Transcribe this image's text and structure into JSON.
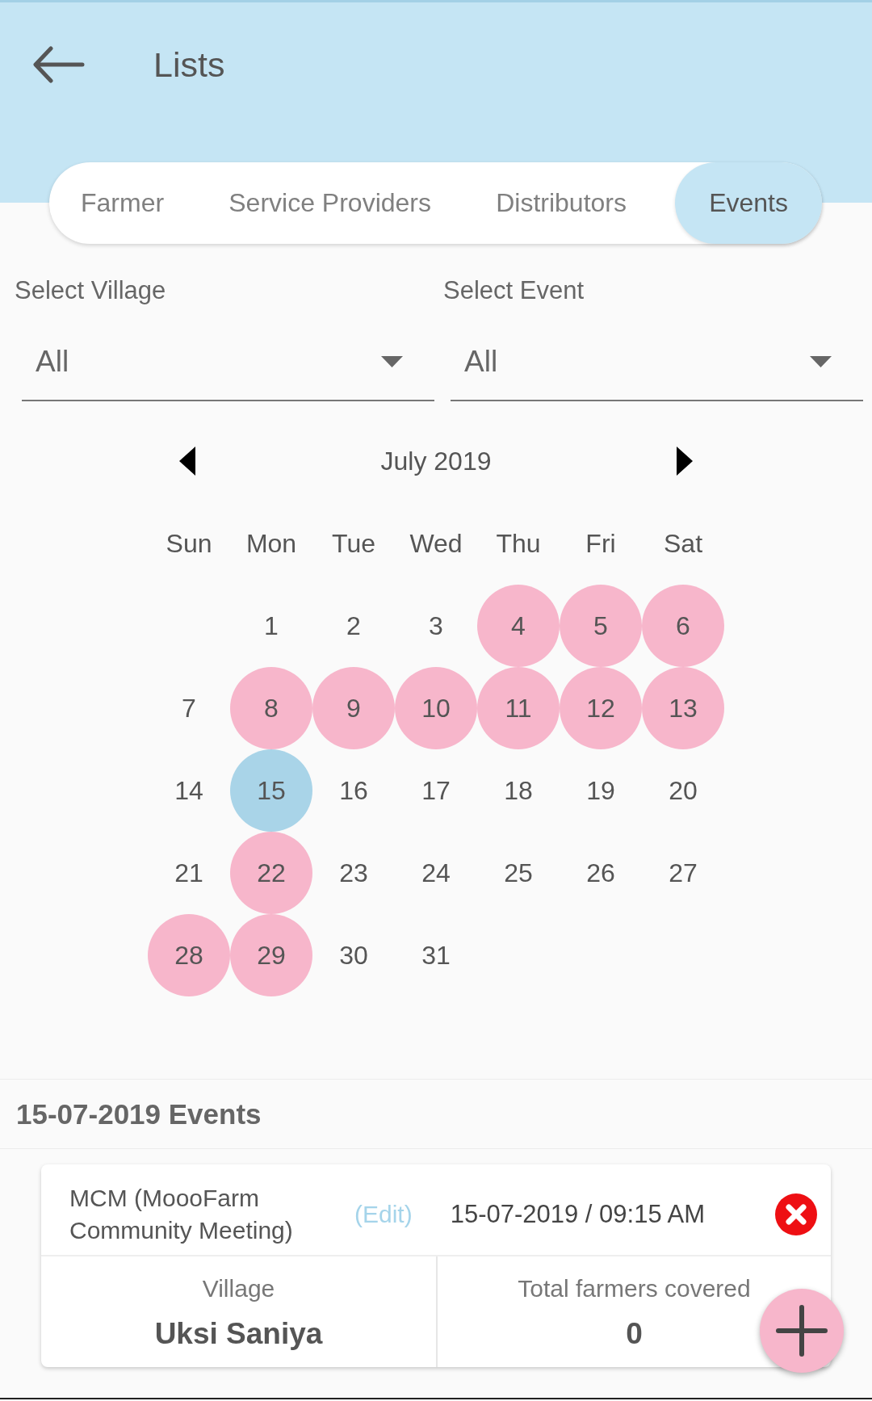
{
  "app_bar": {
    "title": "Lists"
  },
  "tabs": [
    {
      "label": "Farmer",
      "selected": false
    },
    {
      "label": "Service Providers",
      "selected": false
    },
    {
      "label": "Distributors",
      "selected": false
    },
    {
      "label": "Events",
      "selected": true
    }
  ],
  "filters": [
    {
      "label": "Select Village",
      "value": "All"
    },
    {
      "label": "Select Event",
      "value": "All"
    }
  ],
  "calendar": {
    "month": "July 2019",
    "weekdays": [
      "Sun",
      "Mon",
      "Tue",
      "Wed",
      "Thu",
      "Fri",
      "Sat"
    ],
    "weeks": [
      [
        {
          "kind": "blank"
        },
        {
          "kind": "day",
          "day": "1",
          "selected": false,
          "has_event": false
        },
        {
          "kind": "day",
          "day": "2",
          "selected": false,
          "has_event": false
        },
        {
          "kind": "day",
          "day": "3",
          "selected": false,
          "has_event": false
        },
        {
          "kind": "day",
          "day": "4",
          "selected": false,
          "has_event": true
        },
        {
          "kind": "day",
          "day": "5",
          "selected": false,
          "has_event": true
        },
        {
          "kind": "day",
          "day": "6",
          "selected": false,
          "has_event": true
        }
      ],
      [
        {
          "kind": "day",
          "day": "7",
          "selected": false,
          "has_event": false
        },
        {
          "kind": "day",
          "day": "8",
          "selected": false,
          "has_event": true
        },
        {
          "kind": "day",
          "day": "9",
          "selected": false,
          "has_event": true
        },
        {
          "kind": "day",
          "day": "10",
          "selected": false,
          "has_event": true
        },
        {
          "kind": "day",
          "day": "11",
          "selected": false,
          "has_event": true
        },
        {
          "kind": "day",
          "day": "12",
          "selected": false,
          "has_event": true
        },
        {
          "kind": "day",
          "day": "13",
          "selected": false,
          "has_event": true
        }
      ],
      [
        {
          "kind": "day",
          "day": "14",
          "selected": false,
          "has_event": false
        },
        {
          "kind": "day",
          "day": "15",
          "selected": true,
          "has_event": false
        },
        {
          "kind": "day",
          "day": "16",
          "selected": false,
          "has_event": false
        },
        {
          "kind": "day",
          "day": "17",
          "selected": false,
          "has_event": false
        },
        {
          "kind": "day",
          "day": "18",
          "selected": false,
          "has_event": false
        },
        {
          "kind": "day",
          "day": "19",
          "selected": false,
          "has_event": false
        },
        {
          "kind": "day",
          "day": "20",
          "selected": false,
          "has_event": false
        }
      ],
      [
        {
          "kind": "day",
          "day": "21",
          "selected": false,
          "has_event": false
        },
        {
          "kind": "day",
          "day": "22",
          "selected": false,
          "has_event": true
        },
        {
          "kind": "day",
          "day": "23",
          "selected": false,
          "has_event": false
        },
        {
          "kind": "day",
          "day": "24",
          "selected": false,
          "has_event": false
        },
        {
          "kind": "day",
          "day": "25",
          "selected": false,
          "has_event": false
        },
        {
          "kind": "day",
          "day": "26",
          "selected": false,
          "has_event": false
        },
        {
          "kind": "day",
          "day": "27",
          "selected": false,
          "has_event": false
        }
      ],
      [
        {
          "kind": "day",
          "day": "28",
          "selected": false,
          "has_event": true
        },
        {
          "kind": "day",
          "day": "29",
          "selected": false,
          "has_event": true
        },
        {
          "kind": "day",
          "day": "30",
          "selected": false,
          "has_event": false
        },
        {
          "kind": "day",
          "day": "31",
          "selected": false,
          "has_event": false
        }
      ]
    ]
  },
  "events_section": {
    "title": "15-07-2019 Events",
    "events": [
      {
        "name": "MCM (MoooFarm Community Meeting)",
        "edit_label": "(Edit)",
        "datetime": "15-07-2019 / 09:15 AM",
        "fields": [
          {
            "label": "Village",
            "value": "Uksi Saniya"
          },
          {
            "label": "Total farmers covered",
            "value": "0"
          }
        ]
      }
    ]
  }
}
